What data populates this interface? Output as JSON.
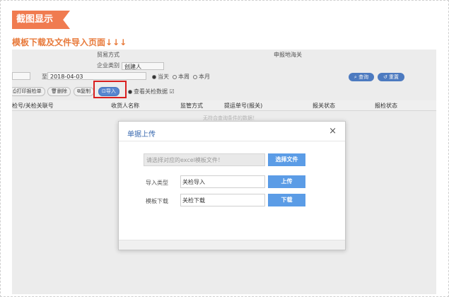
{
  "header": {
    "ribbon_text": "截图显示",
    "subtitle": "模板下载及文件导入页面↓↓↓"
  },
  "form": {
    "trade_mode_label": "贸易方式",
    "declare_port_label": "申报地海关",
    "company_type_label": "企业类别",
    "creator_value": "创建人",
    "date_to_label": "至",
    "date_to_value": "2018-04-03",
    "radio_today": "当天",
    "radio_week": "本周",
    "radio_month": "本月",
    "query_button": "查询",
    "reset_button": "重置"
  },
  "toolbar": {
    "print_label": "打印报检单",
    "delete_label": "删除",
    "copy_label": "复制",
    "import_label": "导入",
    "view_label": "查看关检数据"
  },
  "table": {
    "columns": [
      "检号/关检关联号",
      "收货人名称",
      "监管方式",
      "提运单号(报关)",
      "报关状态",
      "报检状态"
    ],
    "empty_text": "无符合查询条件的数据！"
  },
  "modal": {
    "title": "单据上传",
    "close_symbol": "×",
    "file_placeholder": "请选择对应的excel模板文件！",
    "choose_file_button": "选择文件",
    "import_type_label": "导入类型",
    "import_type_value": "关检导入",
    "upload_button": "上传",
    "template_download_label": "模板下载",
    "template_download_value": "关检下载",
    "download_button": "下载"
  },
  "colors": {
    "ribbon": "#f07b50",
    "subtitle": "#e87a3b",
    "button_blue": "#5b9ce6",
    "highlight_red": "#e02020"
  }
}
